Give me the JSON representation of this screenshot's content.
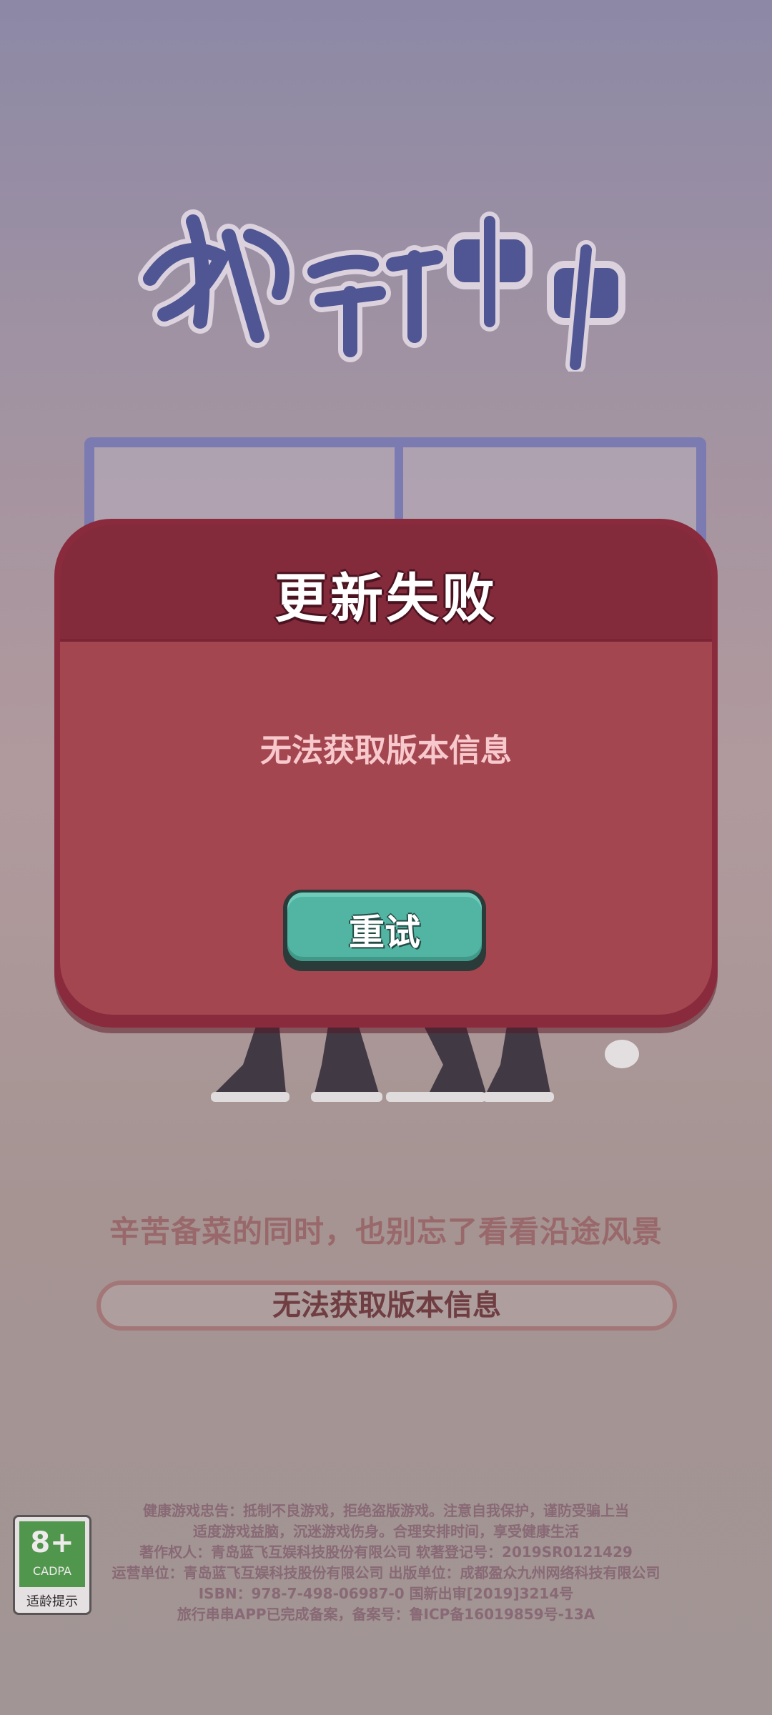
{
  "app": {
    "logo_text": "旅行串串",
    "tagline": "辛苦备菜的同时，也别忘了看看沿途风景",
    "loading_status": "无法获取版本信息"
  },
  "dialog": {
    "title": "更新失败",
    "message": "无法获取版本信息",
    "retry_label": "重试"
  },
  "age_rating": {
    "rating": "8+",
    "org": "CADPA",
    "label": "适龄提示"
  },
  "footer": {
    "lines": [
      "健康游戏忠告：抵制不良游戏，拒绝盗版游戏。注意自我保护，谨防受骗上当",
      "适度游戏益脑，沉迷游戏伤身。合理安排时间，享受健康生活",
      "著作权人：青岛蓝飞互娱科技股份有限公司    软著登记号：2019SR0121429",
      "运营单位：青岛蓝飞互娱科技股份有限公司   出版单位：成都盈众九州网络科技有限公司",
      "ISBN：978-7-498-06987-0   国新出审[2019]3214号",
      "旅行串串APP已完成备案，备案号：鲁ICP备16019859号-13A"
    ]
  },
  "colors": {
    "dialog_border": "#8a2a3d",
    "dialog_body": "#a3464f",
    "retry_button": "#52b4a3",
    "logo_blue": "#4b559a"
  }
}
